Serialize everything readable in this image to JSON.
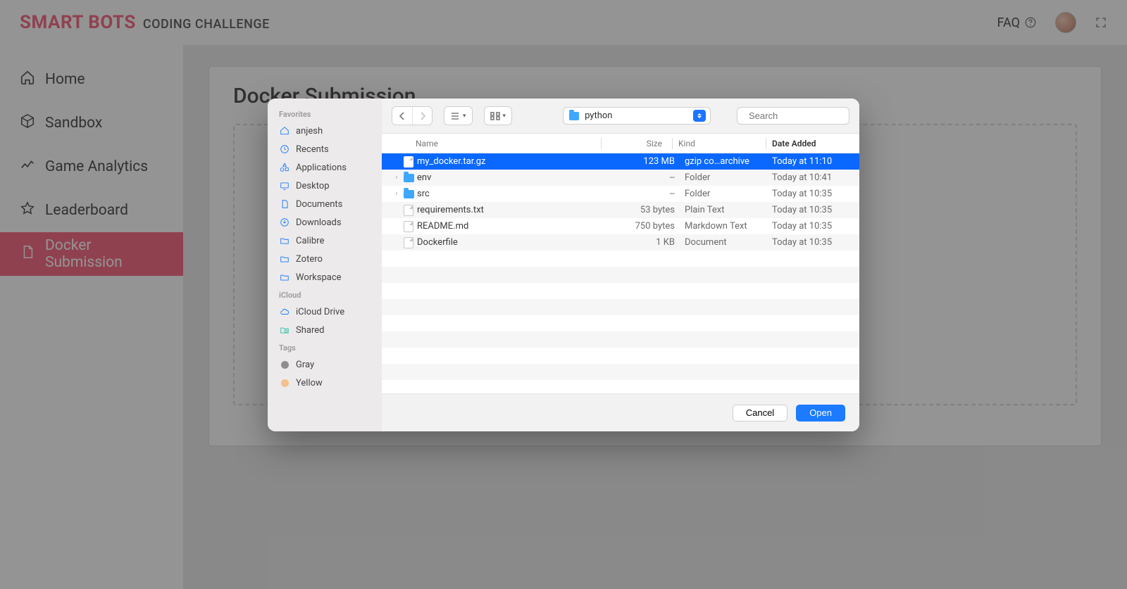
{
  "header": {
    "brand_strong": "SMART BOTS",
    "brand_sub": "CODING CHALLENGE",
    "faq_label": "FAQ"
  },
  "sidebar": {
    "items": [
      {
        "label": "Home",
        "icon": "home-icon"
      },
      {
        "label": "Sandbox",
        "icon": "cube-icon"
      },
      {
        "label": "Game Analytics",
        "icon": "analytics-icon"
      },
      {
        "label": "Leaderboard",
        "icon": "star-icon"
      },
      {
        "label": "Docker Submission",
        "icon": "document-icon"
      }
    ],
    "active_index": 4
  },
  "main": {
    "title": "Docker Submission"
  },
  "dialog": {
    "sidebar": {
      "favorites_label": "Favorites",
      "favorites": [
        {
          "label": "anjesh",
          "icon": "home"
        },
        {
          "label": "Recents",
          "icon": "clock"
        },
        {
          "label": "Applications",
          "icon": "apps"
        },
        {
          "label": "Desktop",
          "icon": "desktop"
        },
        {
          "label": "Documents",
          "icon": "doc"
        },
        {
          "label": "Downloads",
          "icon": "download"
        },
        {
          "label": "Calibre",
          "icon": "folder"
        },
        {
          "label": "Zotero",
          "icon": "folder"
        },
        {
          "label": "Workspace",
          "icon": "folder"
        }
      ],
      "icloud_label": "iCloud",
      "icloud": [
        {
          "label": "iCloud Drive",
          "icon": "cloud"
        },
        {
          "label": "Shared",
          "icon": "shared"
        }
      ],
      "tags_label": "Tags",
      "tags": [
        {
          "label": "Gray",
          "color": "#8e8e8e"
        },
        {
          "label": "Yellow",
          "color": "#f5c18a"
        }
      ]
    },
    "toolbar": {
      "current_folder": "python",
      "search_placeholder": "Search"
    },
    "columns": {
      "name": "Name",
      "size": "Size",
      "kind": "Kind",
      "date": "Date Added"
    },
    "files": [
      {
        "name": "my_docker.tar.gz",
        "size": "123 MB",
        "kind": "gzip co…archive",
        "date": "Today at 11:10",
        "icon": "doc",
        "selected": true,
        "expandable": false
      },
      {
        "name": "env",
        "size": "--",
        "kind": "Folder",
        "date": "Today at 10:41",
        "icon": "folder",
        "selected": false,
        "expandable": true
      },
      {
        "name": "src",
        "size": "--",
        "kind": "Folder",
        "date": "Today at 10:35",
        "icon": "folder",
        "selected": false,
        "expandable": true
      },
      {
        "name": "requirements.txt",
        "size": "53 bytes",
        "kind": "Plain Text",
        "date": "Today at 10:35",
        "icon": "doc",
        "selected": false,
        "expandable": false
      },
      {
        "name": "README.md",
        "size": "750 bytes",
        "kind": "Markdown Text",
        "date": "Today at 10:35",
        "icon": "doc",
        "selected": false,
        "expandable": false
      },
      {
        "name": "Dockerfile",
        "size": "1 KB",
        "kind": "Document",
        "date": "Today at 10:35",
        "icon": "doc",
        "selected": false,
        "expandable": false
      }
    ],
    "footer": {
      "cancel": "Cancel",
      "open": "Open"
    }
  }
}
